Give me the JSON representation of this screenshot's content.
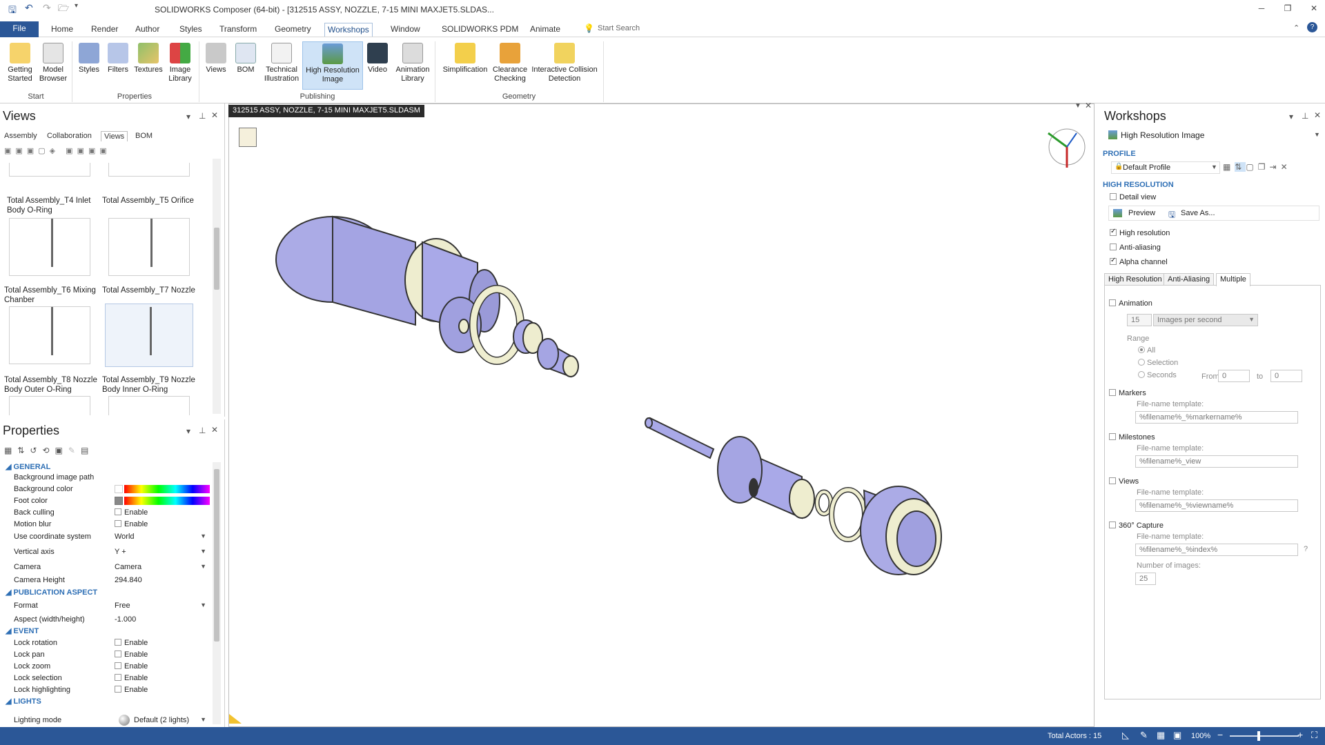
{
  "window": {
    "title": "SOLIDWORKS Composer (64-bit) - [312515 ASSY, NOZZLE, 7-15 MINI MAXJET5.SLDAS...",
    "search_placeholder": "Start Search"
  },
  "menu": [
    "File",
    "Home",
    "Render",
    "Author",
    "Styles",
    "Transform",
    "Geometry",
    "Workshops",
    "Window",
    "SOLIDWORKS PDM",
    "Animate"
  ],
  "ribbon": {
    "buttons": {
      "getting_started": "Getting Started",
      "model_browser": "Model Browser",
      "styles": "Styles",
      "filters": "Filters",
      "textures": "Textures",
      "image_library": "Image Library",
      "views": "Views",
      "bom": "BOM",
      "technical_illustration": "Technical Illustration",
      "high_resolution_image": "High Resolution Image",
      "video": "Video",
      "animation_library": "Animation Library",
      "simplification": "Simplification",
      "clearance_checking": "Clearance Checking",
      "interactive_collision_detection": "Interactive Collision Detection"
    },
    "groups": {
      "start": "Start",
      "properties": "Properties",
      "publishing": "Publishing",
      "geometry": "Geometry"
    }
  },
  "views_panel": {
    "title": "Views",
    "tabs": [
      "Assembly",
      "Collaboration",
      "Views",
      "BOM"
    ],
    "items": [
      "Total Assembly_T4 Inlet Body O-Ring",
      "Total Assembly_T5 Orifice",
      "Total Assembly_T6 Mixing Chanber",
      "Total Assembly_T7 Nozzle",
      "Total Assembly_T8 Nozzle Body Outer O-Ring",
      "Total Assembly_T9 Nozzle Body Inner O-Ring"
    ]
  },
  "properties_panel": {
    "title": "Properties",
    "sections": {
      "general": "GENERAL",
      "publication_aspect": "PUBLICATION ASPECT",
      "event": "EVENT",
      "lights": "LIGHTS"
    },
    "rows": {
      "bg_image_path": "Background image path",
      "bg_color": "Background color",
      "foot_color": "Foot color",
      "back_culling": "Back culling",
      "motion_blur": "Motion blur",
      "coord_system": "Use coordinate system",
      "coord_system_value": "World",
      "vertical_axis": "Vertical axis",
      "vertical_axis_value": "Y +",
      "camera": "Camera",
      "camera_value": "Camera",
      "camera_height": "Camera Height",
      "camera_height_value": "294.840",
      "format": "Format",
      "format_value": "Free",
      "aspect": "Aspect (width/height)",
      "aspect_value": "-1.000",
      "lock_rotation": "Lock rotation",
      "lock_pan": "Lock pan",
      "lock_zoom": "Lock zoom",
      "lock_selection": "Lock selection",
      "lock_highlighting": "Lock highlighting",
      "lighting_mode": "Lighting mode",
      "lighting_mode_value": "Default (2 lights)",
      "enable": "Enable"
    }
  },
  "viewport": {
    "document_tab": "312515 ASSY, NOZZLE, 7-15 MINI MAXJET5.SLDASM"
  },
  "workshops": {
    "title": "Workshops",
    "selected_workshop": "High Resolution Image",
    "profile_heading": "PROFILE",
    "profile_value": "Default Profile",
    "hr_heading": "HIGH RESOLUTION",
    "detail_view": "Detail view",
    "preview": "Preview",
    "save_as": "Save As...",
    "high_resolution": "High resolution",
    "anti_aliasing": "Anti-aliasing",
    "alpha_channel": "Alpha channel",
    "tabs": [
      "High Resolution",
      "Anti-Aliasing",
      "Multiple"
    ],
    "animation": "Animation",
    "images_count": "15",
    "images_per_second": "Images per second",
    "range": "Range",
    "range_all": "All",
    "range_selection": "Selection",
    "range_seconds": "Seconds",
    "from": "From",
    "from_value": "0",
    "to": "to",
    "to_value": "0",
    "markers": "Markers",
    "file_name_template": "File-name template:",
    "markers_template": "%filename%_%markername%",
    "milestones": "Milestones",
    "milestones_template": "%filename%_view",
    "views": "Views",
    "views_template": "%filename%_%viewname%",
    "capture360": "360° Capture",
    "capture_template": "%filename%_%index%",
    "number_of_images": "Number of images:",
    "number_of_images_value": "25",
    "help": "?"
  },
  "status": {
    "total_actors": "Total Actors : 15",
    "zoom": "100%"
  },
  "colors": {
    "accent": "#2b5797",
    "section_blue": "#2e6fb5",
    "part_blue": "#a9a9e8",
    "part_tan": "#efeed0"
  }
}
